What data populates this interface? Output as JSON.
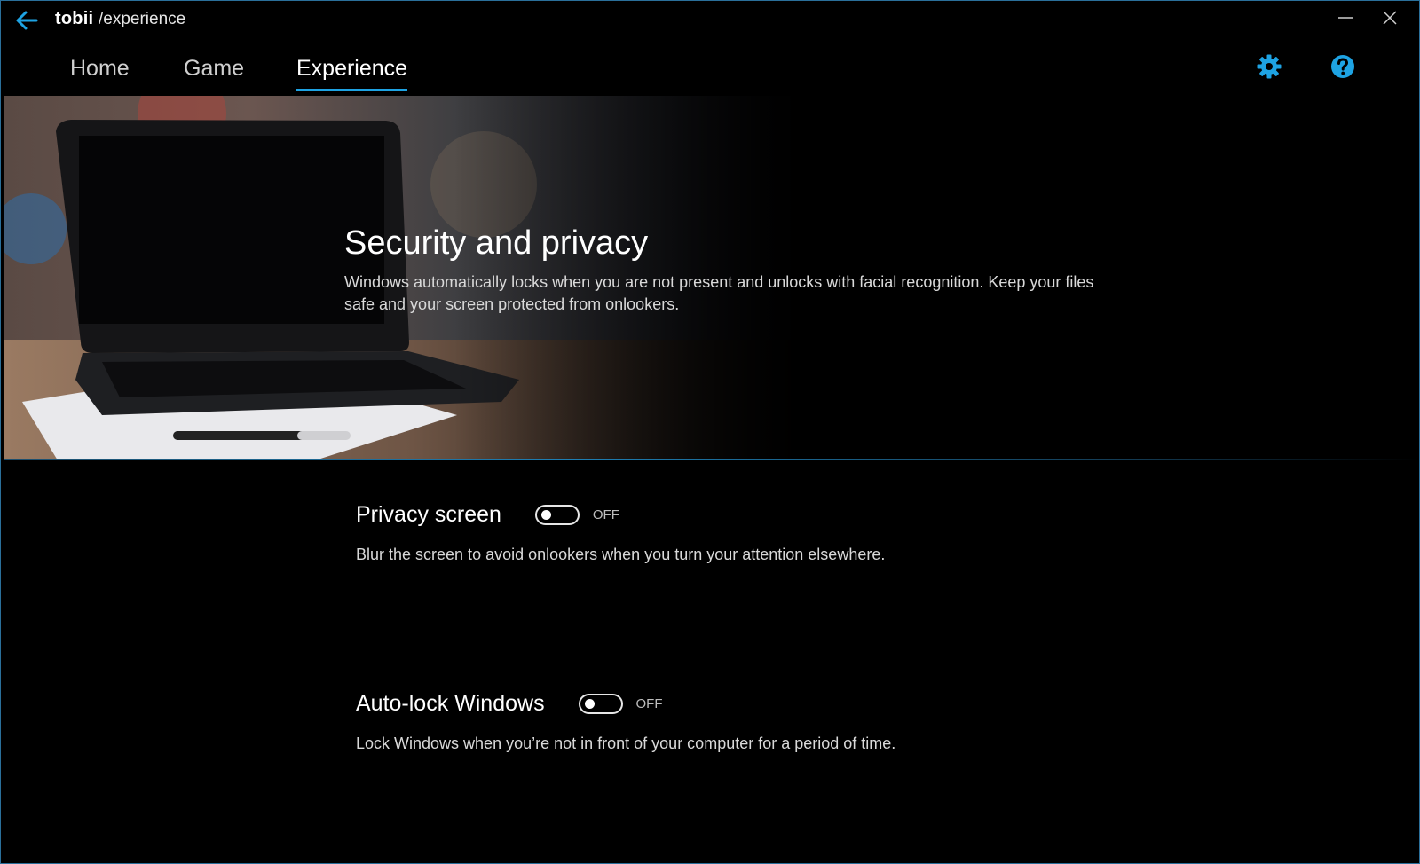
{
  "titlebar": {
    "brand": "tobii",
    "breadcrumb": "/experience"
  },
  "nav": {
    "tabs": [
      {
        "label": "Home",
        "active": false
      },
      {
        "label": "Game",
        "active": false
      },
      {
        "label": "Experience",
        "active": true
      }
    ]
  },
  "hero": {
    "title": "Security and privacy",
    "description": "Windows automatically locks when you are not present and unlocks with facial recognition. Keep your files safe and your screen protected from onlookers."
  },
  "settings": [
    {
      "title": "Privacy screen",
      "state": "OFF",
      "description": "Blur the screen to avoid onlookers when you turn your attention elsewhere."
    },
    {
      "title": "Auto-lock Windows",
      "state": "OFF",
      "description": "Lock Windows when you’re not in front of your computer for a period of time."
    }
  ],
  "colors": {
    "accent": "#1ea3e3",
    "background": "#000000"
  },
  "icons": {
    "back": "back-arrow-icon",
    "minimize": "minimize-icon",
    "close": "close-icon",
    "settings": "gear-icon",
    "help": "help-icon"
  }
}
